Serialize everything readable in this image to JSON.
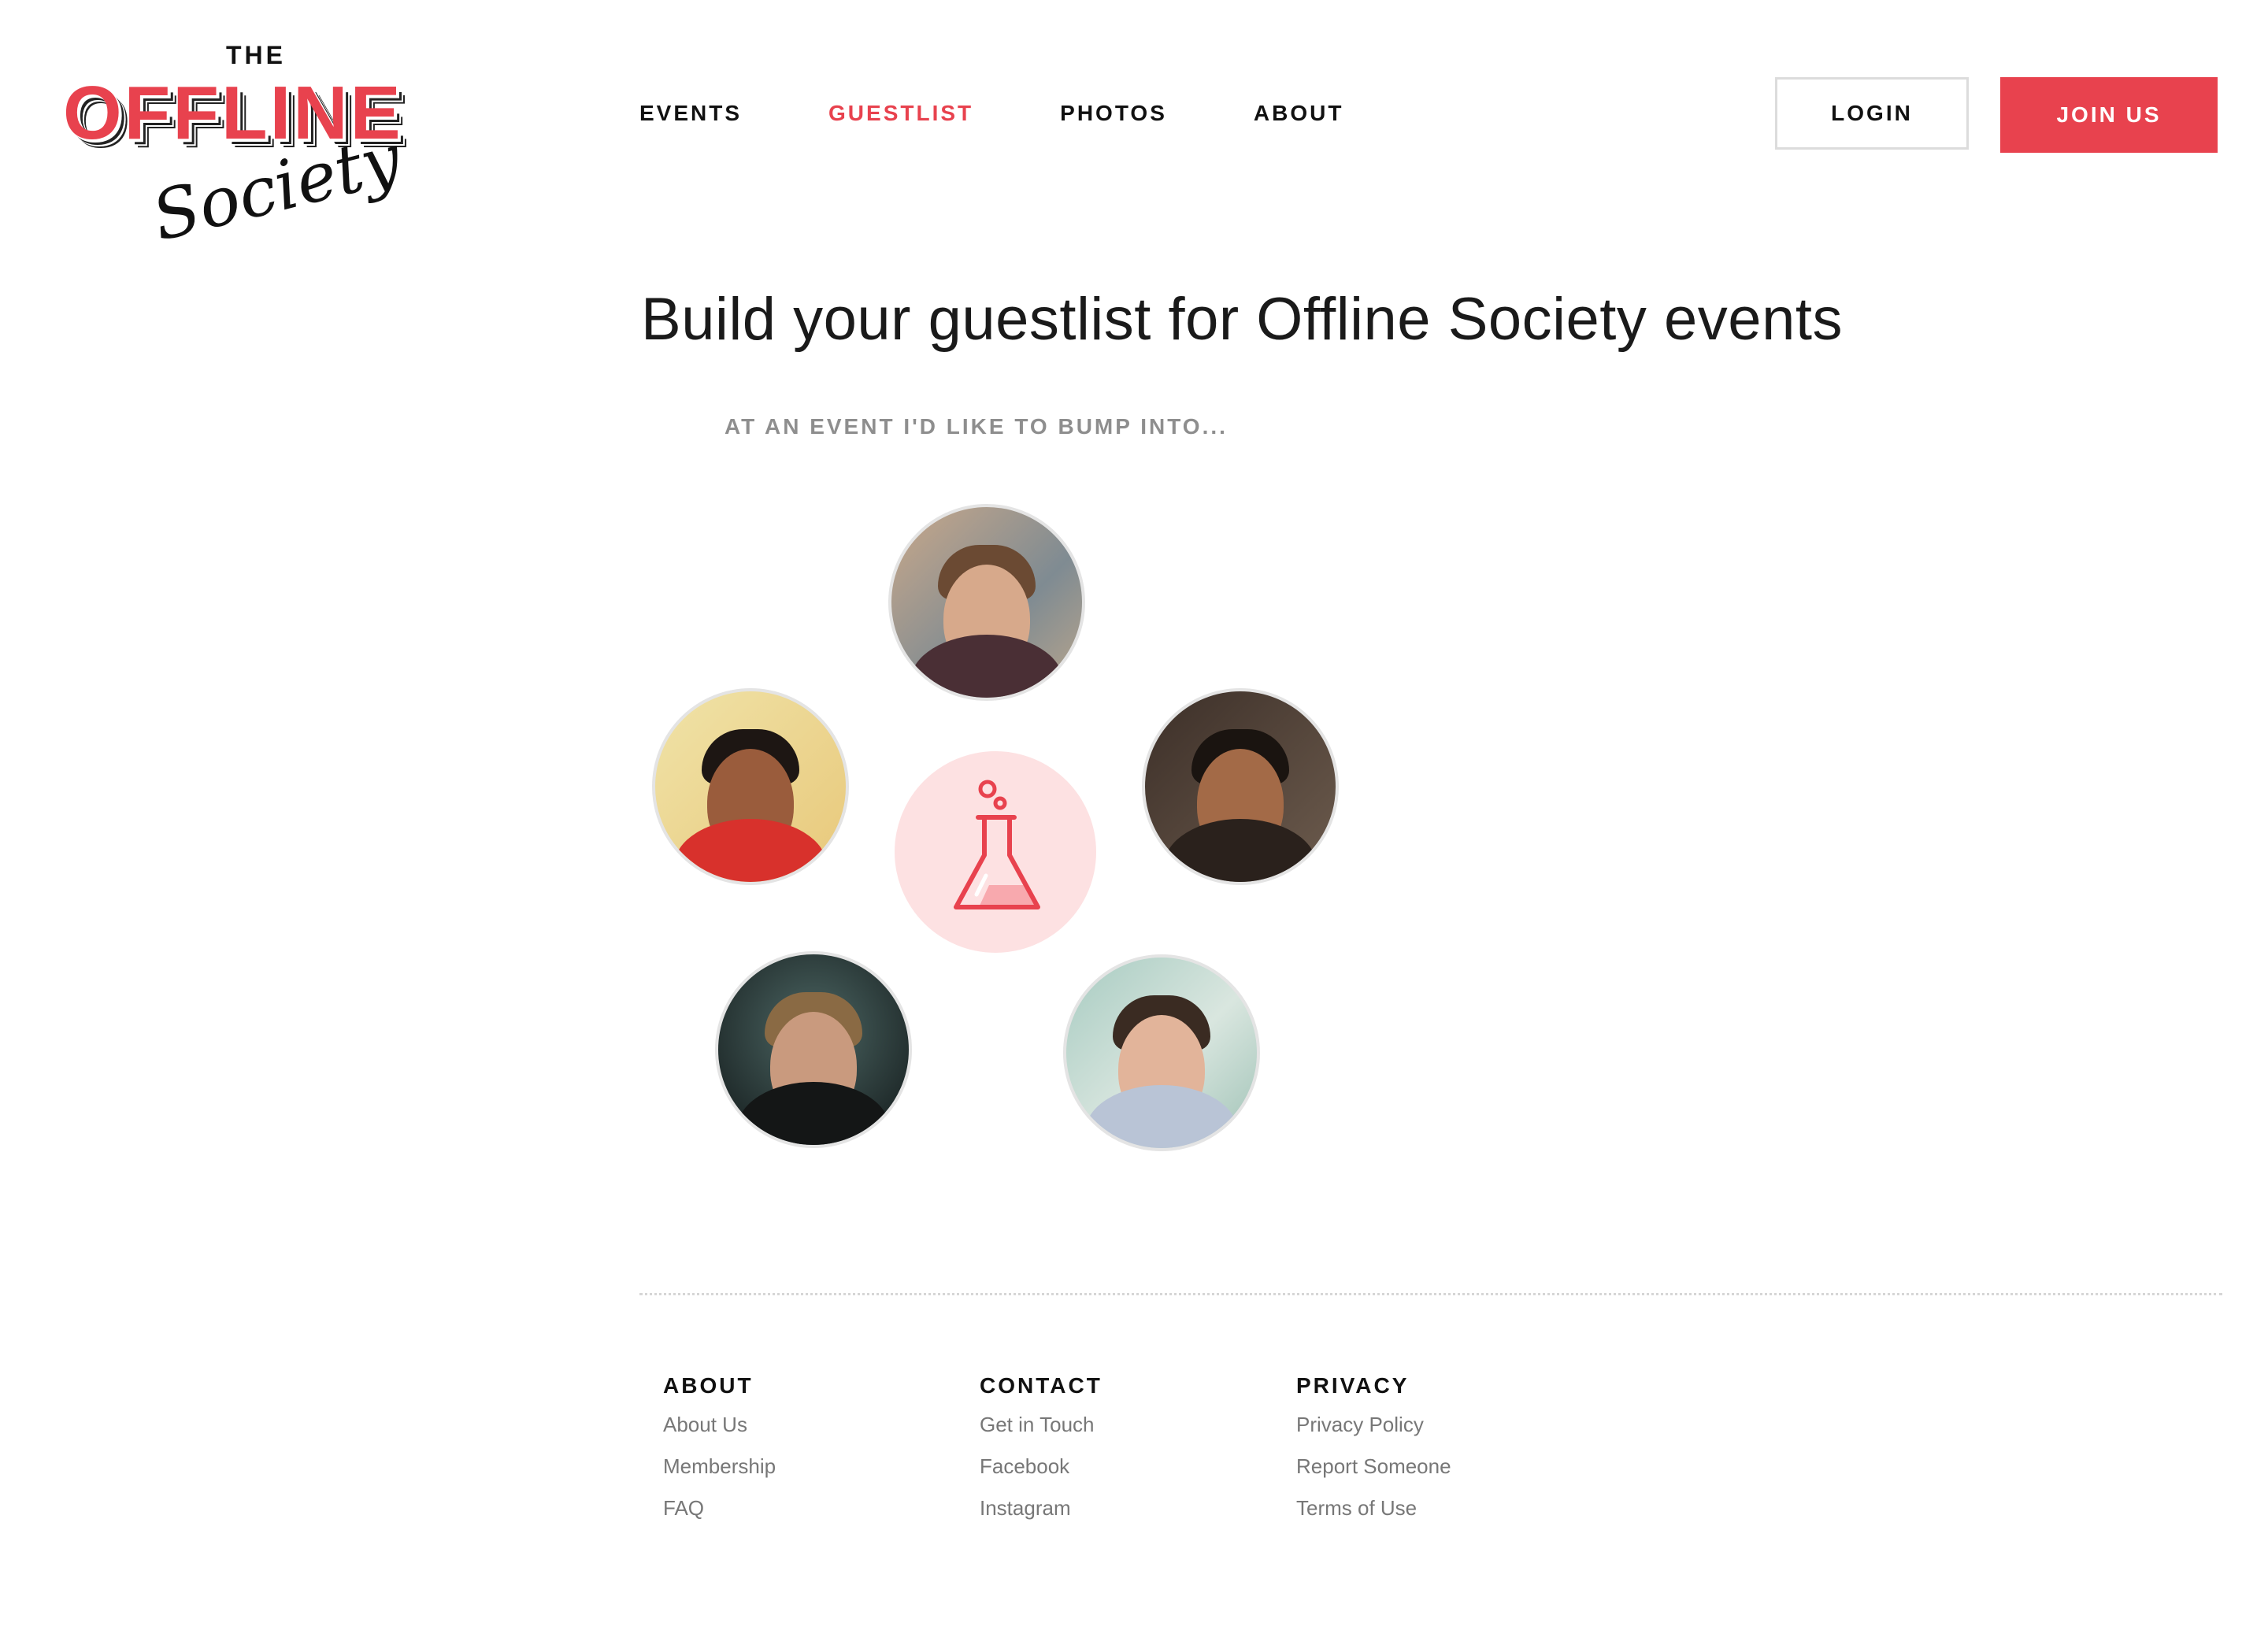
{
  "logo": {
    "the": "THE",
    "offline": "OFFLINE",
    "society": "Society"
  },
  "nav": {
    "items": [
      {
        "label": "EVENTS",
        "active": false
      },
      {
        "label": "GUESTLIST",
        "active": true
      },
      {
        "label": "PHOTOS",
        "active": false
      },
      {
        "label": "ABOUT",
        "active": false
      }
    ],
    "login_label": "LOGIN",
    "join_label": "JOIN US"
  },
  "main": {
    "title": "Build your guestlist for Offline Society events",
    "subtitle": "AT AN EVENT I'D LIKE TO BUMP INTO...",
    "center_icon": "flask-icon"
  },
  "footer": {
    "columns": [
      {
        "heading": "ABOUT",
        "links": [
          "About Us",
          "Membership",
          "FAQ"
        ]
      },
      {
        "heading": "CONTACT",
        "links": [
          "Get in Touch",
          "Facebook",
          "Instagram"
        ]
      },
      {
        "heading": "PRIVACY",
        "links": [
          "Privacy Policy",
          "Report Someone",
          "Terms of Use"
        ]
      }
    ]
  },
  "colors": {
    "accent": "#e8424e",
    "accent_light": "#fde1e2",
    "muted": "#8e8e8e"
  }
}
